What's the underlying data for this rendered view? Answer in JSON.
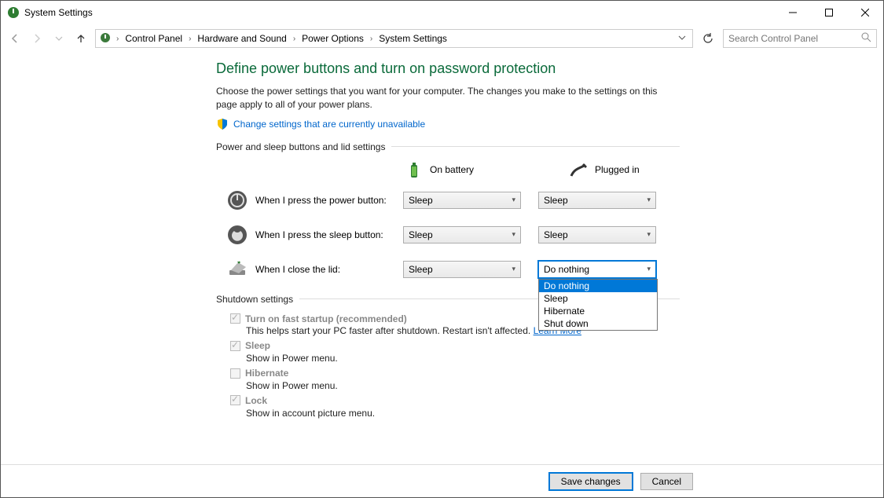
{
  "window": {
    "title": "System Settings"
  },
  "breadcrumbs": [
    "Control Panel",
    "Hardware and Sound",
    "Power Options",
    "System Settings"
  ],
  "search": {
    "placeholder": "Search Control Panel"
  },
  "page": {
    "heading": "Define power buttons and turn on password protection",
    "description": "Choose the power settings that you want for your computer. The changes you make to the settings on this page apply to all of your power plans.",
    "admin_link": "Change settings that are currently unavailable"
  },
  "group1": {
    "title": "Power and sleep buttons and lid settings"
  },
  "modes": {
    "battery": "On battery",
    "plugged": "Plugged in"
  },
  "rows": {
    "power": {
      "label": "When I press the power button:",
      "battery": "Sleep",
      "plugged": "Sleep"
    },
    "sleep": {
      "label": "When I press the sleep button:",
      "battery": "Sleep",
      "plugged": "Sleep"
    },
    "lid": {
      "label": "When I close the lid:",
      "battery": "Sleep",
      "plugged": "Do nothing"
    }
  },
  "lid_plugged_options": [
    "Do nothing",
    "Sleep",
    "Hibernate",
    "Shut down"
  ],
  "group2": {
    "title": "Shutdown settings"
  },
  "shutdown": {
    "fast": {
      "checked": true,
      "label": "Turn on fast startup (recommended)",
      "sub_pre": "This helps start your PC faster after shutdown. Restart isn't affected. ",
      "learn": "Learn More"
    },
    "sleep": {
      "checked": true,
      "label": "Sleep",
      "sub": "Show in Power menu."
    },
    "hib": {
      "checked": false,
      "label": "Hibernate",
      "sub": "Show in Power menu."
    },
    "lock": {
      "checked": true,
      "label": "Lock",
      "sub": "Show in account picture menu."
    }
  },
  "buttons": {
    "save": "Save changes",
    "cancel": "Cancel"
  }
}
